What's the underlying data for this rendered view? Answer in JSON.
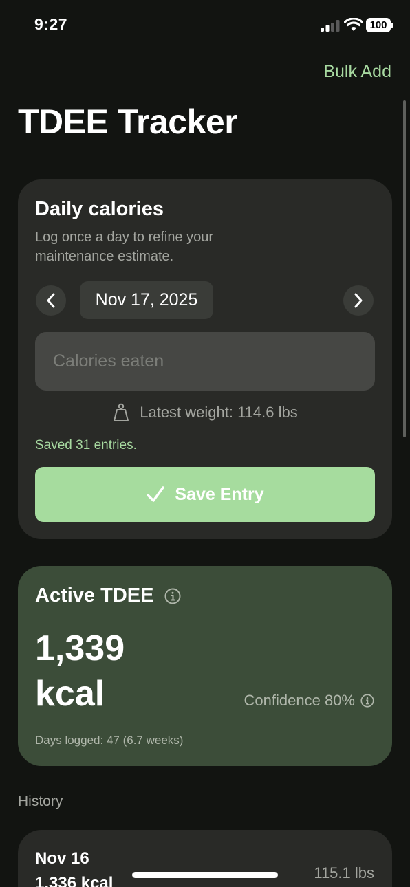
{
  "status_bar": {
    "time": "9:27",
    "battery": "100"
  },
  "header": {
    "bulk_add_label": "Bulk Add",
    "title": "TDEE Tracker"
  },
  "daily_card": {
    "title": "Daily calories",
    "subtitle": "Log once a day to refine your maintenance estimate.",
    "date": "Nov 17, 2025",
    "calories_placeholder": "Calories eaten",
    "calories_value": "",
    "latest_weight": "Latest weight: 114.6 lbs",
    "saved_message": "Saved 31 entries.",
    "save_label": "Save Entry"
  },
  "tdee_card": {
    "title": "Active TDEE",
    "value": "1,339",
    "unit": "kcal",
    "confidence": "Confidence 80%",
    "days_logged": "Days logged: 47 (6.7 weeks)"
  },
  "history": {
    "label": "History",
    "entries": [
      {
        "date": "Nov 16",
        "kcal": "1,336 kcal",
        "weight": "115.1 lbs"
      }
    ]
  },
  "colors": {
    "background": "#121411",
    "accent_green": "#a7d9a0",
    "card": "#292a27",
    "tdee_card": "#3c4d39"
  },
  "icons": [
    "signal-icon",
    "wifi-icon",
    "battery-icon",
    "chevron-left-icon",
    "chevron-right-icon",
    "scale-icon",
    "checkmark-icon",
    "info-icon"
  ]
}
